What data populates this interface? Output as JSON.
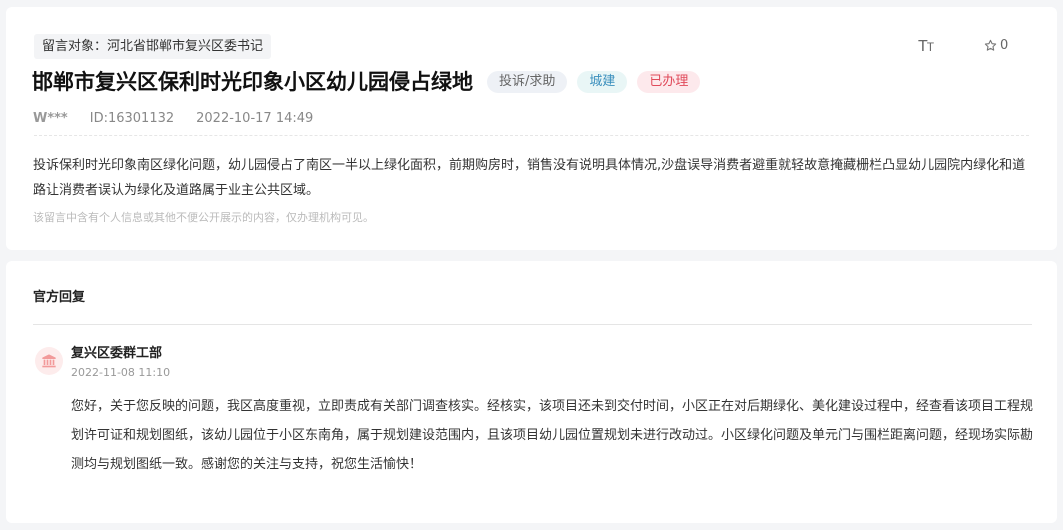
{
  "message": {
    "target_label": "留言对象：河北省邯郸市复兴区委书记",
    "font_size_label_big": "T",
    "font_size_label_small": "T",
    "star_count": "0",
    "title": "邯郸市复兴区保利时光印象小区幼儿园侵占绿地",
    "badges": {
      "type": "投诉/求助",
      "category": "城建",
      "status": "已办理"
    },
    "user": "W***",
    "id": "ID:16301132",
    "datetime": "2022-10-17 14:49",
    "content": "投诉保利时光印象南区绿化问题，幼儿园侵占了南区一半以上绿化面积，前期购房时，销售没有说明具体情况,沙盘误导消费者避重就轻故意掩藏栅栏凸显幼儿园院内绿化和道路让消费者误认为绿化及道路属于业主公共区域。",
    "privacy_notice": "该留言中含有个人信息或其他不便公开展示的内容，仅办理机构可见。"
  },
  "reply": {
    "section_title": "官方回复",
    "department": "复兴区委群工部",
    "datetime": "2022-11-08 11:10",
    "content": "您好，关于您反映的问题，我区高度重视，立即责成有关部门调查核实。经核实，该项目还未到交付时间，小区正在对后期绿化、美化建设过程中，经查看该项目工程规划许可证和规划图纸，该幼儿园位于小区东南角，属于规划建设范围内，且该项目幼儿园位置规划未进行改动过。小区绿化问题及单元门与围栏距离问题，经现场实际勘测均与规划图纸一致。感谢您的关注与支持，祝您生活愉快！"
  },
  "colors": {
    "status_red": "#e04a5a",
    "category_blue": "#3b8fbd",
    "page_bg": "#f4f5f7"
  },
  "icons": {
    "font_size": "font-size-icon",
    "star": "star-icon",
    "avatar": "government-building-icon"
  }
}
